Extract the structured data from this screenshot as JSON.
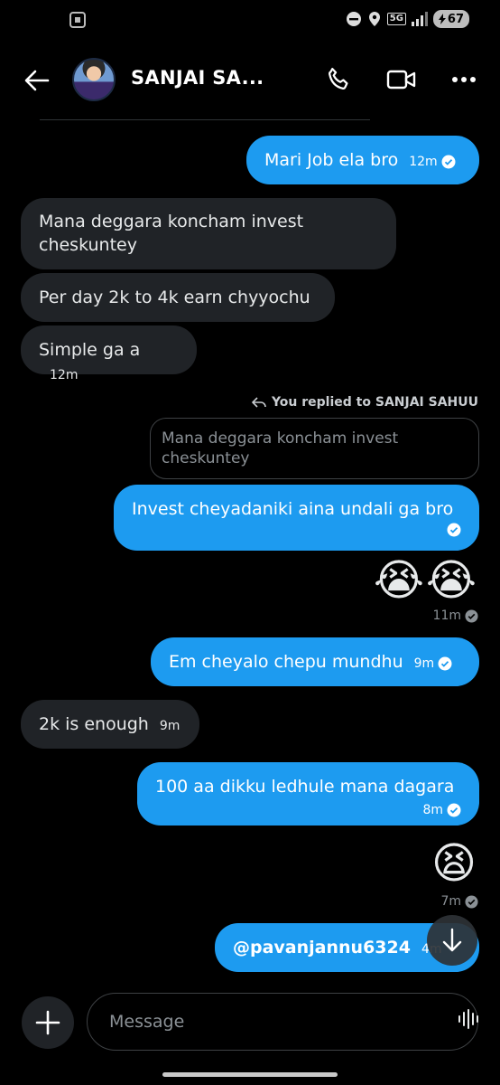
{
  "status_bar": {
    "network": "5G",
    "battery": "67"
  },
  "header": {
    "contact_name": "SANJAI SA..."
  },
  "messages": [
    {
      "text": "Mari Job ela bro",
      "time": "12m"
    },
    {
      "text": "Mana deggara koncham invest cheskuntey"
    },
    {
      "text": "Per day 2k to 4k earn chyyochu"
    },
    {
      "text": "Simple ga a",
      "time": "12m"
    },
    {
      "reply_note": "You replied to SANJAI SAHUU",
      "quoted": "Mana deggara koncham invest cheskuntey",
      "text": "Invest cheyadaniki aina undali ga bro"
    },
    {
      "text": "😭😭",
      "time": "11m"
    },
    {
      "text": "Em cheyalo chepu mundhu",
      "time": "9m"
    },
    {
      "text": "2k is enough",
      "time": "9m"
    },
    {
      "text": "100 aa dikku ledhule mana dagara",
      "time": "8m"
    },
    {
      "text": "😫",
      "time": "7m"
    },
    {
      "text": "@pavanjannu6324",
      "time": "4m"
    }
  ],
  "composer": {
    "placeholder": "Message"
  },
  "colors": {
    "accent": "#1d9bf0",
    "incoming_bubble": "#202327",
    "background": "#000000"
  }
}
